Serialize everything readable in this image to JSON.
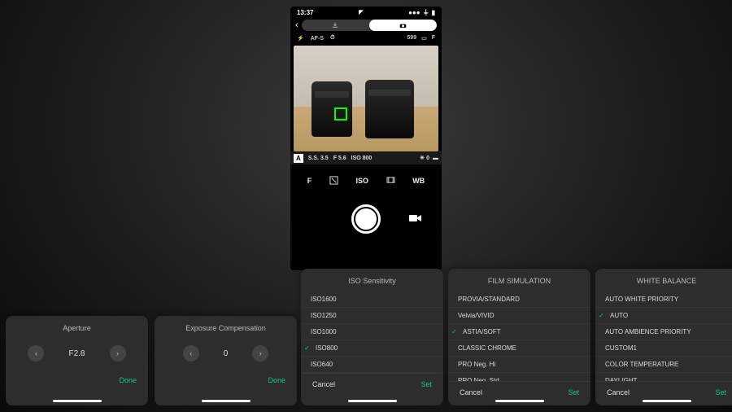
{
  "statusbar": {
    "time": "13:37"
  },
  "info": {
    "shots": "599",
    "mode1": "AF-S"
  },
  "exposure": {
    "mode": "A",
    "ss": "S.S. 3.5",
    "f": "F  5.6",
    "iso": "ISO 800",
    "ev": "0"
  },
  "controls": {
    "f": "F",
    "ev": "☀",
    "iso": "ISO",
    "film": "⚑",
    "wb": "WB"
  },
  "sheets": {
    "aperture": {
      "title": "Aperture",
      "value": "F2.8",
      "done": "Done"
    },
    "expcomp": {
      "title": "Exposure Compensation",
      "value": "0",
      "done": "Done"
    },
    "iso": {
      "title": "ISO Sensitivity",
      "items": [
        "ISO1600",
        "ISO1250",
        "ISO1000",
        "ISO800",
        "ISO640"
      ],
      "selected": "ISO800",
      "cancel": "Cancel",
      "set": "Set"
    },
    "film": {
      "title": "FILM SIMULATION",
      "items": [
        "PROVIA/STANDARD",
        "Velvia/VIVID",
        "ASTIA/SOFT",
        "CLASSIC CHROME",
        "PRO Neg. Hi",
        "PRO Neg. Std"
      ],
      "selected": "ASTIA/SOFT",
      "cancel": "Cancel",
      "set": "Set"
    },
    "wb": {
      "title": "WHITE BALANCE",
      "items": [
        "AUTO WHITE PRIORITY",
        "AUTO",
        "AUTO AMBIENCE PRIORITY",
        "CUSTOM1",
        "COLOR TEMPERATURE",
        "DAYLIGHT"
      ],
      "selected": "AUTO",
      "cancel": "Cancel",
      "set": "Set"
    }
  }
}
